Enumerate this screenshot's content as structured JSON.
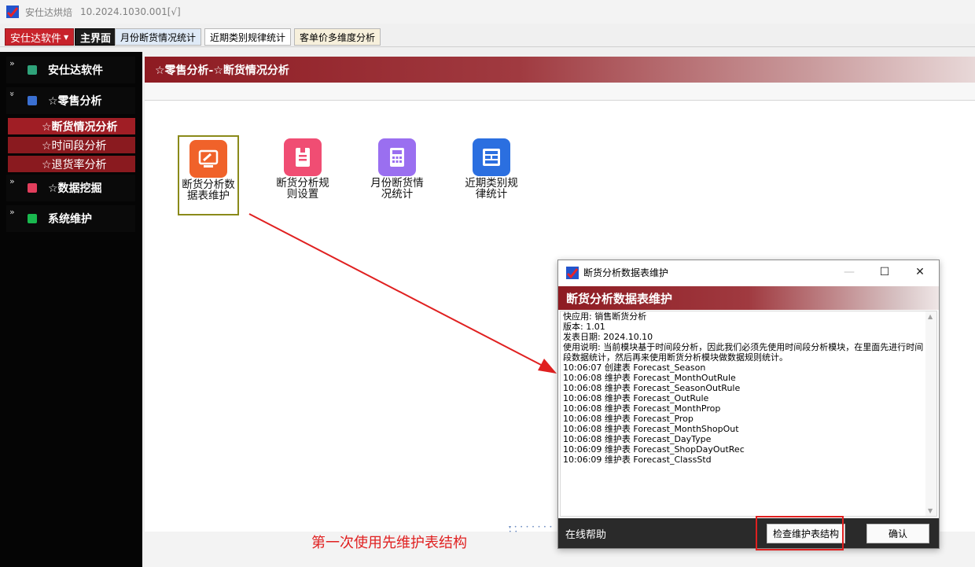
{
  "window": {
    "title": "安仕达烘焙",
    "version": "10.2024.1030.001[√]"
  },
  "menu": {
    "label": "安仕达软件"
  },
  "tabs": [
    {
      "label": "主界面"
    },
    {
      "label": "月份断货情况统计"
    },
    {
      "label": "近期类别规律统计"
    },
    {
      "label": "客单价多维度分析"
    }
  ],
  "sidebar": {
    "groups": [
      {
        "label": "安仕达软件",
        "color": "#2fa37a"
      },
      {
        "label": "☆零售分析",
        "color": "#3a6fd1"
      },
      {
        "label": "☆数据挖掘",
        "color": "#e23e5c"
      },
      {
        "label": "系统维护",
        "color": "#19b84e"
      }
    ],
    "sub_items": [
      {
        "label": "☆断货情况分析"
      },
      {
        "label": "☆时间段分析"
      },
      {
        "label": "☆退货率分析"
      }
    ]
  },
  "page": {
    "title": "☆零售分析-☆断货情况分析"
  },
  "tiles": [
    {
      "label": "断货分析数据表维护",
      "color": "#f0622a"
    },
    {
      "label": "断货分析规则设置",
      "color": "#f04d73"
    },
    {
      "label": "月份断货情况统计",
      "color": "#9a6ff0"
    },
    {
      "label": "近期类别规律统计",
      "color": "#2b6fe0"
    }
  ],
  "dialog": {
    "title": "断货分析数据表维护",
    "header": "断货分析数据表维护",
    "log": [
      "快应用: 销售断货分析",
      "版本: 1.01",
      "发表日期: 2024.10.10",
      "使用说明: 当前模块基于时间段分析，因此我们必须先使用时间段分析模块，在里面先进行时间段数据统计，然后再来使用断货分析模块做数据规则统计。",
      "10:06:07 创建表 Forecast_Season",
      "10:06:08 维护表 Forecast_MonthOutRule",
      "10:06:08 维护表 Forecast_SeasonOutRule",
      "10:06:08 维护表 Forecast_OutRule",
      "10:06:08 维护表 Forecast_MonthProp",
      "10:06:08 维护表 Forecast_Prop",
      "10:06:08 维护表 Forecast_MonthShopOut",
      "10:06:08 维护表 Forecast_DayType",
      "10:06:09 维护表 Forecast_ShopDayOutRec",
      "10:06:09 维护表 Forecast_ClassStd"
    ],
    "help_label": "在线帮助",
    "check_label": "检查维护表结构",
    "ok_label": "确认"
  },
  "annotation": {
    "caption": "第一次使用先维护表结构"
  },
  "colors": {
    "accent_red": "#8e1b22",
    "annotation_red": "#e02020"
  }
}
